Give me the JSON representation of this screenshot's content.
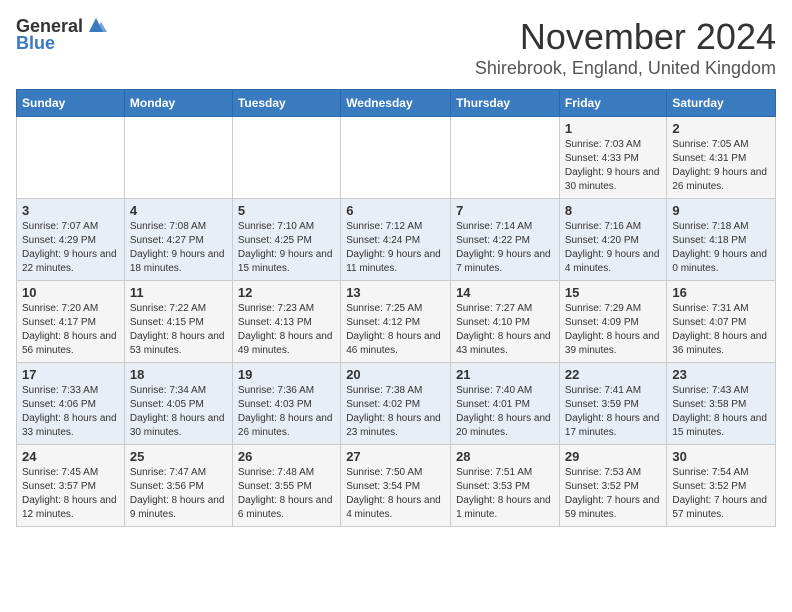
{
  "app": {
    "name_general": "General",
    "name_blue": "Blue"
  },
  "header": {
    "month": "November 2024",
    "location": "Shirebrook, England, United Kingdom"
  },
  "weekdays": [
    "Sunday",
    "Monday",
    "Tuesday",
    "Wednesday",
    "Thursday",
    "Friday",
    "Saturday"
  ],
  "weeks": [
    [
      {
        "day": "",
        "info": ""
      },
      {
        "day": "",
        "info": ""
      },
      {
        "day": "",
        "info": ""
      },
      {
        "day": "",
        "info": ""
      },
      {
        "day": "",
        "info": ""
      },
      {
        "day": "1",
        "info": "Sunrise: 7:03 AM\nSunset: 4:33 PM\nDaylight: 9 hours and 30 minutes."
      },
      {
        "day": "2",
        "info": "Sunrise: 7:05 AM\nSunset: 4:31 PM\nDaylight: 9 hours and 26 minutes."
      }
    ],
    [
      {
        "day": "3",
        "info": "Sunrise: 7:07 AM\nSunset: 4:29 PM\nDaylight: 9 hours and 22 minutes."
      },
      {
        "day": "4",
        "info": "Sunrise: 7:08 AM\nSunset: 4:27 PM\nDaylight: 9 hours and 18 minutes."
      },
      {
        "day": "5",
        "info": "Sunrise: 7:10 AM\nSunset: 4:25 PM\nDaylight: 9 hours and 15 minutes."
      },
      {
        "day": "6",
        "info": "Sunrise: 7:12 AM\nSunset: 4:24 PM\nDaylight: 9 hours and 11 minutes."
      },
      {
        "day": "7",
        "info": "Sunrise: 7:14 AM\nSunset: 4:22 PM\nDaylight: 9 hours and 7 minutes."
      },
      {
        "day": "8",
        "info": "Sunrise: 7:16 AM\nSunset: 4:20 PM\nDaylight: 9 hours and 4 minutes."
      },
      {
        "day": "9",
        "info": "Sunrise: 7:18 AM\nSunset: 4:18 PM\nDaylight: 9 hours and 0 minutes."
      }
    ],
    [
      {
        "day": "10",
        "info": "Sunrise: 7:20 AM\nSunset: 4:17 PM\nDaylight: 8 hours and 56 minutes."
      },
      {
        "day": "11",
        "info": "Sunrise: 7:22 AM\nSunset: 4:15 PM\nDaylight: 8 hours and 53 minutes."
      },
      {
        "day": "12",
        "info": "Sunrise: 7:23 AM\nSunset: 4:13 PM\nDaylight: 8 hours and 49 minutes."
      },
      {
        "day": "13",
        "info": "Sunrise: 7:25 AM\nSunset: 4:12 PM\nDaylight: 8 hours and 46 minutes."
      },
      {
        "day": "14",
        "info": "Sunrise: 7:27 AM\nSunset: 4:10 PM\nDaylight: 8 hours and 43 minutes."
      },
      {
        "day": "15",
        "info": "Sunrise: 7:29 AM\nSunset: 4:09 PM\nDaylight: 8 hours and 39 minutes."
      },
      {
        "day": "16",
        "info": "Sunrise: 7:31 AM\nSunset: 4:07 PM\nDaylight: 8 hours and 36 minutes."
      }
    ],
    [
      {
        "day": "17",
        "info": "Sunrise: 7:33 AM\nSunset: 4:06 PM\nDaylight: 8 hours and 33 minutes."
      },
      {
        "day": "18",
        "info": "Sunrise: 7:34 AM\nSunset: 4:05 PM\nDaylight: 8 hours and 30 minutes."
      },
      {
        "day": "19",
        "info": "Sunrise: 7:36 AM\nSunset: 4:03 PM\nDaylight: 8 hours and 26 minutes."
      },
      {
        "day": "20",
        "info": "Sunrise: 7:38 AM\nSunset: 4:02 PM\nDaylight: 8 hours and 23 minutes."
      },
      {
        "day": "21",
        "info": "Sunrise: 7:40 AM\nSunset: 4:01 PM\nDaylight: 8 hours and 20 minutes."
      },
      {
        "day": "22",
        "info": "Sunrise: 7:41 AM\nSunset: 3:59 PM\nDaylight: 8 hours and 17 minutes."
      },
      {
        "day": "23",
        "info": "Sunrise: 7:43 AM\nSunset: 3:58 PM\nDaylight: 8 hours and 15 minutes."
      }
    ],
    [
      {
        "day": "24",
        "info": "Sunrise: 7:45 AM\nSunset: 3:57 PM\nDaylight: 8 hours and 12 minutes."
      },
      {
        "day": "25",
        "info": "Sunrise: 7:47 AM\nSunset: 3:56 PM\nDaylight: 8 hours and 9 minutes."
      },
      {
        "day": "26",
        "info": "Sunrise: 7:48 AM\nSunset: 3:55 PM\nDaylight: 8 hours and 6 minutes."
      },
      {
        "day": "27",
        "info": "Sunrise: 7:50 AM\nSunset: 3:54 PM\nDaylight: 8 hours and 4 minutes."
      },
      {
        "day": "28",
        "info": "Sunrise: 7:51 AM\nSunset: 3:53 PM\nDaylight: 8 hours and 1 minute."
      },
      {
        "day": "29",
        "info": "Sunrise: 7:53 AM\nSunset: 3:52 PM\nDaylight: 7 hours and 59 minutes."
      },
      {
        "day": "30",
        "info": "Sunrise: 7:54 AM\nSunset: 3:52 PM\nDaylight: 7 hours and 57 minutes."
      }
    ]
  ]
}
